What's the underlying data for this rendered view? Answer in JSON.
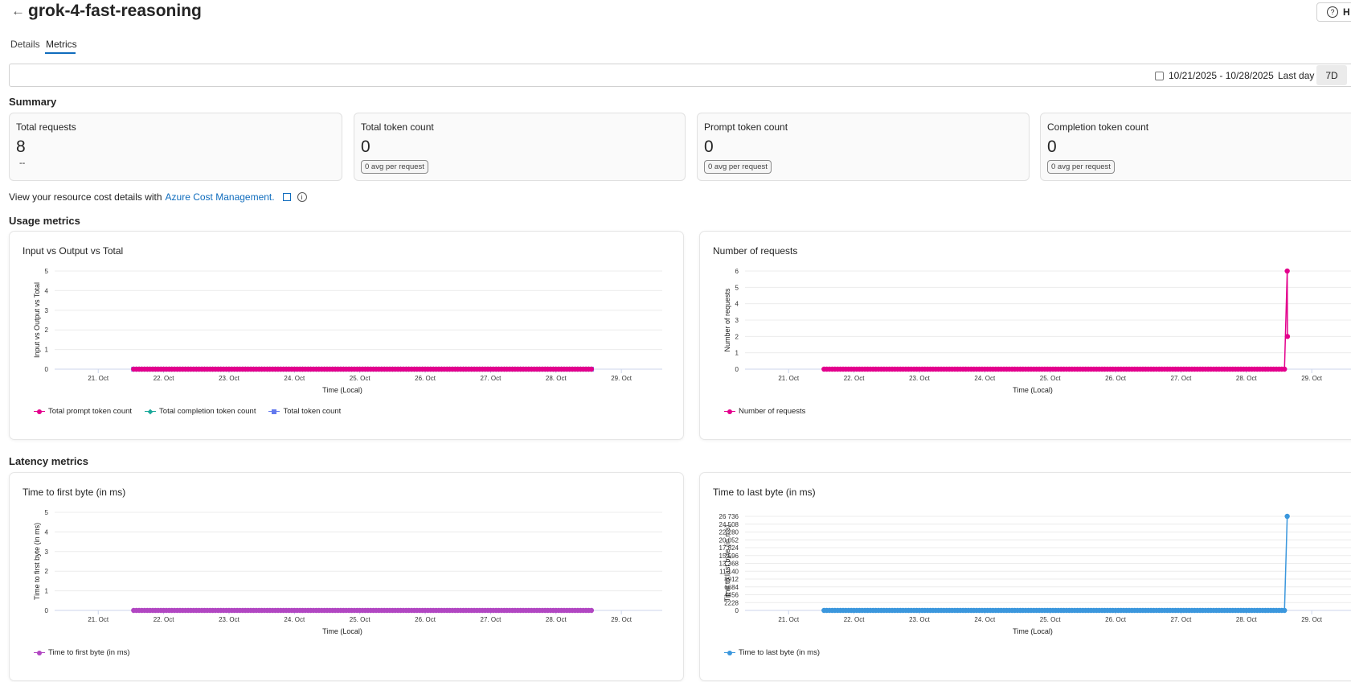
{
  "header": {
    "title": "grok-4-fast-reasoning",
    "back_icon": "arrow-left-icon",
    "help_label": "H"
  },
  "tabs": [
    {
      "label": "Details",
      "active": false
    },
    {
      "label": "Metrics",
      "active": true
    }
  ],
  "filter": {
    "date_range": "10/21/2025 - 10/28/2025",
    "last_day_label": "Last day",
    "seven_day_label": "7D",
    "selected": "7D"
  },
  "summary": {
    "heading": "Summary",
    "cards": [
      {
        "label": "Total requests",
        "value": "8",
        "sub": "--"
      },
      {
        "label": "Total token count",
        "value": "0",
        "badge": "0 avg per request"
      },
      {
        "label": "Prompt token count",
        "value": "0",
        "badge": "0 avg per request"
      },
      {
        "label": "Completion token count",
        "value": "0",
        "badge": "0 avg per request"
      }
    ]
  },
  "cost": {
    "text": "View your resource cost details with",
    "link": "Azure Cost Management."
  },
  "sections": {
    "usage": "Usage metrics",
    "latency": "Latency metrics"
  },
  "colors": {
    "accent": "#0f6cbd",
    "prompt": "#e3008c",
    "completion": "#1aa89a",
    "total": "#6379ee",
    "ttfb": "#b146c2",
    "ttlb": "#3b97dd"
  },
  "chart_data": [
    {
      "type": "line",
      "title": "Input vs Output vs Total",
      "ylabel": "Input vs Output vs Total",
      "xlabel": "Time (Local)",
      "x_domain": [
        "2025-10-20 08:00",
        "2025-10-29 15:00"
      ],
      "x_ticks": [
        {
          "date": "2025-10-21",
          "label": "21. Oct"
        },
        {
          "date": "2025-10-22",
          "label": "22. Oct"
        },
        {
          "date": "2025-10-23",
          "label": "23. Oct"
        },
        {
          "date": "2025-10-24",
          "label": "24. Oct"
        },
        {
          "date": "2025-10-25",
          "label": "25. Oct"
        },
        {
          "date": "2025-10-26",
          "label": "26. Oct"
        },
        {
          "date": "2025-10-27",
          "label": "27. Oct"
        },
        {
          "date": "2025-10-28",
          "label": "28. Oct"
        },
        {
          "date": "2025-10-29",
          "label": "29. Oct"
        }
      ],
      "y_ticks": [
        "0",
        "1",
        "2",
        "3",
        "4",
        "5"
      ],
      "ylim": [
        0,
        5
      ],
      "grid": true,
      "legend": "bottom-left",
      "series": [
        {
          "name": "Total prompt token count",
          "color": "#e3008c",
          "marker": "circle",
          "range": [
            "2025-10-21 13:00",
            "2025-10-28 13:00"
          ],
          "value": 0,
          "points": []
        },
        {
          "name": "Total completion token count",
          "color": "#1aa89a",
          "marker": "diamond",
          "range": [
            "2025-10-21 13:00",
            "2025-10-28 13:00"
          ],
          "value": 0,
          "points": []
        },
        {
          "name": "Total token count",
          "color": "#6379ee",
          "marker": "square",
          "range": [
            "2025-10-21 13:00",
            "2025-10-28 13:00"
          ],
          "value": 0,
          "points": []
        }
      ]
    },
    {
      "type": "line",
      "title": "Number of requests",
      "ylabel": "Number of requests",
      "xlabel": "Time (Local)",
      "x_domain": [
        "2025-10-20 08:00",
        "2025-10-29 15:00"
      ],
      "x_ticks": [
        {
          "date": "2025-10-21",
          "label": "21. Oct"
        },
        {
          "date": "2025-10-22",
          "label": "22. Oct"
        },
        {
          "date": "2025-10-23",
          "label": "23. Oct"
        },
        {
          "date": "2025-10-24",
          "label": "24. Oct"
        },
        {
          "date": "2025-10-25",
          "label": "25. Oct"
        },
        {
          "date": "2025-10-26",
          "label": "26. Oct"
        },
        {
          "date": "2025-10-27",
          "label": "27. Oct"
        },
        {
          "date": "2025-10-28",
          "label": "28. Oct"
        },
        {
          "date": "2025-10-29",
          "label": "29. Oct"
        }
      ],
      "y_ticks": [
        "0",
        "1",
        "2",
        "3",
        "4",
        "5",
        "6"
      ],
      "ylim": [
        0,
        6
      ],
      "grid": true,
      "legend": "bottom-left",
      "series": [
        {
          "name": "Number of requests",
          "color": "#e3008c",
          "marker": "circle",
          "range": [
            "2025-10-21 13:00",
            "2025-10-28 14:00"
          ],
          "value": 0,
          "points": [
            [
              "2025-10-28 15:00",
              6
            ],
            [
              "2025-10-28 15:05",
              2
            ]
          ]
        }
      ]
    },
    {
      "type": "line",
      "title": "Time to first byte (in ms)",
      "ylabel": "Time to first byte (in ms)",
      "xlabel": "Time (Local)",
      "x_domain": [
        "2025-10-20 08:00",
        "2025-10-29 15:00"
      ],
      "x_ticks": [
        {
          "date": "2025-10-21",
          "label": "21. Oct"
        },
        {
          "date": "2025-10-22",
          "label": "22. Oct"
        },
        {
          "date": "2025-10-23",
          "label": "23. Oct"
        },
        {
          "date": "2025-10-24",
          "label": "24. Oct"
        },
        {
          "date": "2025-10-25",
          "label": "25. Oct"
        },
        {
          "date": "2025-10-26",
          "label": "26. Oct"
        },
        {
          "date": "2025-10-27",
          "label": "27. Oct"
        },
        {
          "date": "2025-10-28",
          "label": "28. Oct"
        },
        {
          "date": "2025-10-29",
          "label": "29. Oct"
        }
      ],
      "y_ticks": [
        "0",
        "1",
        "2",
        "3",
        "4",
        "5"
      ],
      "ylim": [
        0,
        5
      ],
      "grid": true,
      "legend": "bottom-left",
      "series": [
        {
          "name": "Time to first byte (in ms)",
          "color": "#b146c2",
          "marker": "circle",
          "range": [
            "2025-10-21 13:00",
            "2025-10-28 13:00"
          ],
          "value": 0,
          "points": []
        }
      ]
    },
    {
      "type": "line",
      "title": "Time to last byte (in ms)",
      "ylabel": "Time to last byte (in ms)",
      "xlabel": "Time (Local)",
      "x_domain": [
        "2025-10-20 08:00",
        "2025-10-29 15:00"
      ],
      "x_ticks": [
        {
          "date": "2025-10-21",
          "label": "21. Oct"
        },
        {
          "date": "2025-10-22",
          "label": "22. Oct"
        },
        {
          "date": "2025-10-23",
          "label": "23. Oct"
        },
        {
          "date": "2025-10-24",
          "label": "24. Oct"
        },
        {
          "date": "2025-10-25",
          "label": "25. Oct"
        },
        {
          "date": "2025-10-26",
          "label": "26. Oct"
        },
        {
          "date": "2025-10-27",
          "label": "27. Oct"
        },
        {
          "date": "2025-10-28",
          "label": "28. Oct"
        },
        {
          "date": "2025-10-29",
          "label": "29. Oct"
        }
      ],
      "y_ticks": [
        "0",
        "2228",
        "4456",
        "6684",
        "8912",
        "11 140",
        "13 368",
        "15 596",
        "17 824",
        "20 052",
        "22 280",
        "24 508",
        "26 736"
      ],
      "ylim": [
        0,
        26736
      ],
      "grid": true,
      "legend": "bottom-left",
      "series": [
        {
          "name": "Time to last byte (in ms)",
          "color": "#3b97dd",
          "marker": "circle",
          "range": [
            "2025-10-21 13:00",
            "2025-10-28 14:00"
          ],
          "value": 0,
          "points": [
            [
              "2025-10-28 15:00",
              26736
            ]
          ]
        }
      ]
    }
  ]
}
